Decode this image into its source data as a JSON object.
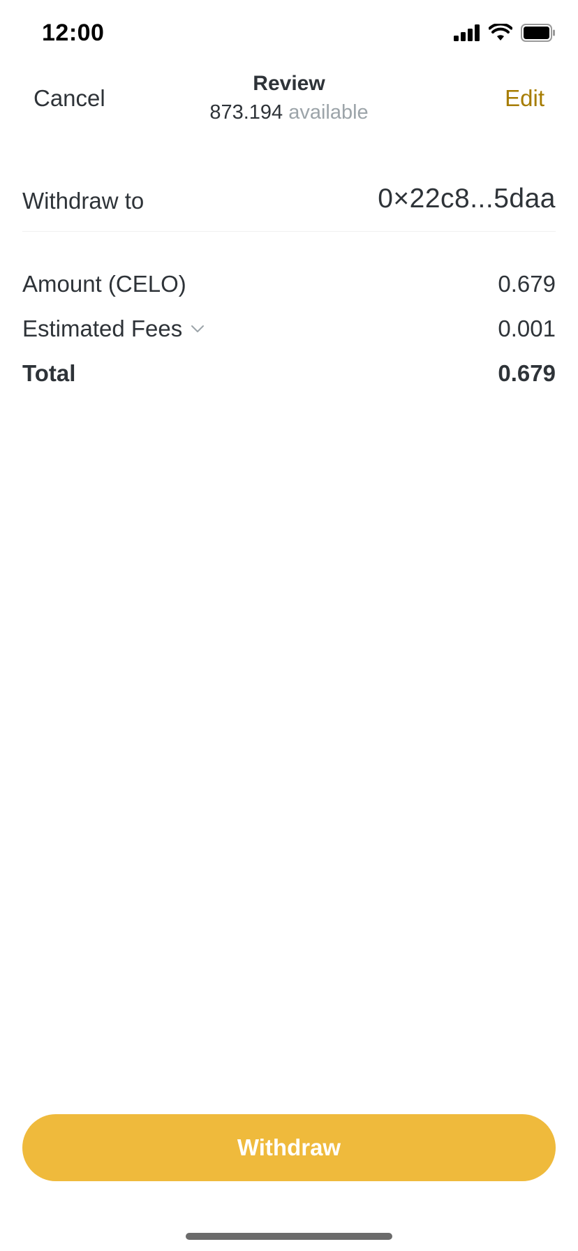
{
  "status_bar": {
    "time": "12:00",
    "icons": [
      "cellular-signal-icon",
      "wifi-icon",
      "battery-icon"
    ]
  },
  "header": {
    "cancel_label": "Cancel",
    "title": "Review",
    "balance": "873.194",
    "available_label": "available",
    "edit_label": "Edit"
  },
  "withdraw": {
    "label": "Withdraw to",
    "address": "0×22c8...5daa"
  },
  "summary": {
    "amount_label": "Amount (CELO)",
    "amount_value": "0.679",
    "fees_label": "Estimated Fees",
    "fees_value": "0.001",
    "total_label": "Total",
    "total_value": "0.679"
  },
  "actions": {
    "withdraw_button_label": "Withdraw"
  },
  "colors": {
    "text": "#2e3338",
    "muted": "#9ca4a9",
    "accent_link": "#a67c00",
    "button_bg": "#efba3c",
    "button_text": "#ffffff"
  }
}
